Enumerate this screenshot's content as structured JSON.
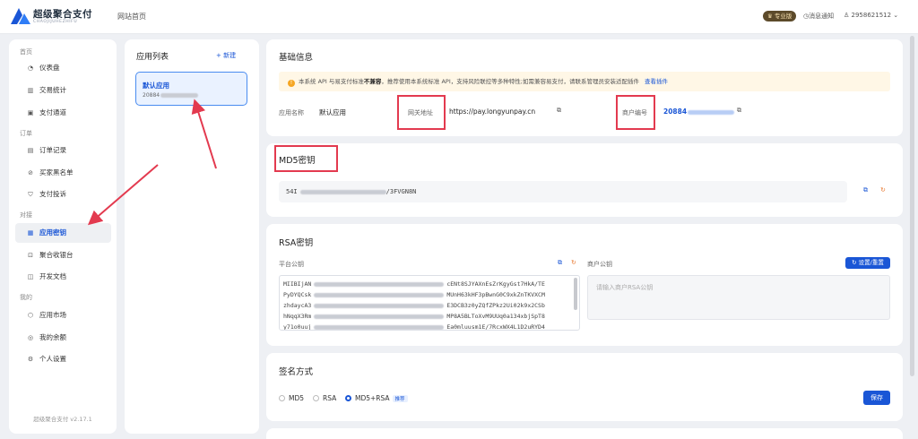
{
  "topbar": {
    "logo_title": "超级聚合支付",
    "logo_sub": "CHAOJIJUHEZHIFU",
    "nav_home": "网站首页",
    "pro_badge": "专业版",
    "notice": "消息通知",
    "user": "2958621512"
  },
  "sidebar": {
    "sections": [
      {
        "label": "首页"
      },
      {
        "label": "订单"
      },
      {
        "label": "对接"
      },
      {
        "label": "我的"
      }
    ],
    "items": [
      {
        "label": "仪表盘",
        "icon": "dashboard-icon"
      },
      {
        "label": "交易统计",
        "icon": "bar-chart-icon"
      },
      {
        "label": "支付通道",
        "icon": "channel-icon"
      },
      {
        "label": "订单记录",
        "icon": "order-icon"
      },
      {
        "label": "买家黑名单",
        "icon": "blacklist-icon"
      },
      {
        "label": "支付投诉",
        "icon": "complaint-icon"
      },
      {
        "label": "应用密钥",
        "icon": "key-icon"
      },
      {
        "label": "聚合收银台",
        "icon": "cashier-icon"
      },
      {
        "label": "开发文档",
        "icon": "book-icon"
      },
      {
        "label": "应用市场",
        "icon": "market-icon"
      },
      {
        "label": "我的余额",
        "icon": "wallet-icon"
      },
      {
        "label": "个人设置",
        "icon": "settings-icon"
      }
    ],
    "version": "超级聚合支付 v2.17.1"
  },
  "applist": {
    "title": "应用列表",
    "new_label": "新建",
    "app_name": "默认应用",
    "app_id_prefix": "20884"
  },
  "basic": {
    "title": "基础信息",
    "warning_pre": "本系统 API 与易支付标准",
    "warning_bold": "不兼容",
    "warning_post": "，推荐使用本系统标准 API，支持风险联控等多种特性;如需兼容易支付，请联系管理员安装适配插件",
    "warning_link": "查看插件",
    "app_name_label": "应用名称",
    "app_name_value": "默认应用",
    "gateway_label": "网关地址",
    "gateway_value": "https://pay.longyunpay.cn",
    "merchant_label": "商户编号",
    "merchant_value_prefix": "20884"
  },
  "md5": {
    "title": "MD5密钥",
    "key_prefix": "54I",
    "key_suffix": "/3FVGN8N"
  },
  "rsa": {
    "title": "RSA密钥",
    "platform_label": "平台公钥",
    "merchant_label": "商户公钥",
    "set_button": "设置/重置",
    "merchant_placeholder": "请输入商户RSA公钥",
    "lines": [
      {
        "start": "MIIBIjAN",
        "end": "cENt8SJYAXnEsZrKgyGst7HkA/TE"
      },
      {
        "start": "PyDYQCsk",
        "end": "MUnH63kHF3pBwnG0C9xkZnTKVXCM"
      },
      {
        "start": "zhdaycA3",
        "end": "E3DCB3z0yZQfZPkz2Ui02k9x2CSb"
      },
      {
        "start": "hNqqX3Rm",
        "end": "MP8A5BLToXvM9UUq0a134xbjSpT8"
      },
      {
        "start": "y71o0uuj",
        "end": "Ea0mluusm1E/7RcxWX4L1D2uRYD4"
      }
    ]
  },
  "sign": {
    "title": "签名方式",
    "options": [
      "MD5",
      "RSA",
      "MD5+RSA"
    ],
    "selected": "MD5+RSA",
    "recommend": "推荐",
    "save_button": "保存"
  },
  "colors": {
    "primary": "#1a56d6",
    "annotation": "#e33a4f",
    "warning_bg": "#fff7e6"
  }
}
